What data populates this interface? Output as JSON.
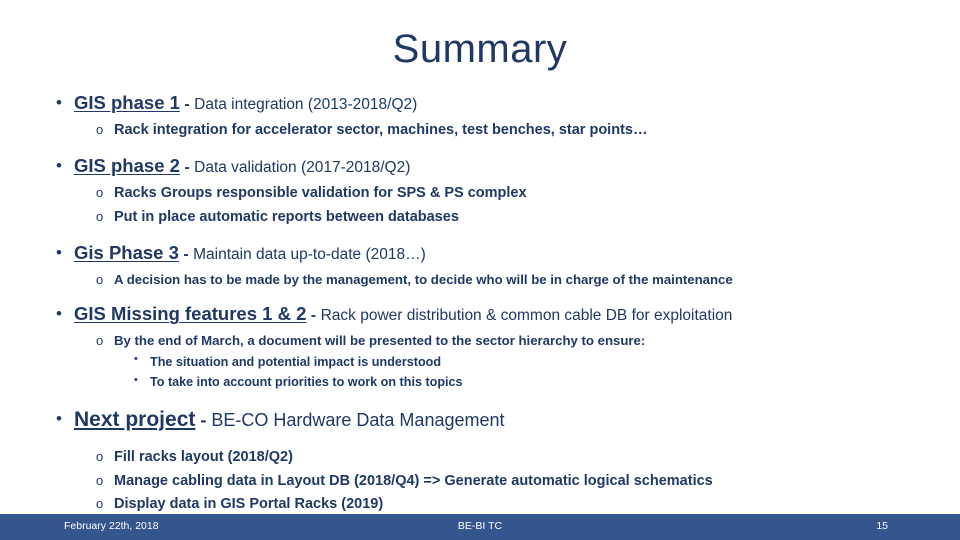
{
  "slide": {
    "title": "Summary",
    "accent_color": "#1f3864",
    "footer_color": "#35558f"
  },
  "markers": {
    "level1": "•",
    "level2": "o",
    "level3": "•"
  },
  "blocks": [
    {
      "head": "GIS phase 1",
      "dash": " - ",
      "tail": "Data integration (2013-2018/Q2)",
      "subs": [
        "Rack integration for accelerator sector, machines, test benches, star points…"
      ]
    },
    {
      "head": "GIS phase 2",
      "dash": " - ",
      "tail": "Data validation (2017-2018/Q2)",
      "subs": [
        "Racks Groups responsible validation for SPS & PS complex",
        "Put in place automatic reports between databases"
      ]
    },
    {
      "head": "Gis Phase 3",
      "dash": " - ",
      "tail": "Maintain data up-to-date (2018…)",
      "subs": [
        "A decision has to be made by the management, to decide who will be in charge of the maintenance"
      ]
    },
    {
      "head": "GIS Missing features 1 & 2",
      "dash": " - ",
      "tail": "Rack power distribution & common cable DB for exploitation",
      "subs": [
        "By the end of March, a document will be presented to the sector hierarchy to ensure:"
      ],
      "subsubs": [
        "The situation and potential impact is understood",
        "To take into account priorities to work on this topics"
      ]
    },
    {
      "head": "Next project",
      "dash": " - ",
      "tail": "BE-CO Hardware Data Management",
      "subs": [
        "Fill racks layout (2018/Q2)",
        "Manage cabling data in Layout DB (2018/Q4) => Generate automatic logical schematics",
        "Display data in GIS Portal Racks (2019)"
      ]
    }
  ],
  "footer": {
    "date": "February 22th, 2018",
    "center": "BE-BI TC",
    "page": "15"
  }
}
